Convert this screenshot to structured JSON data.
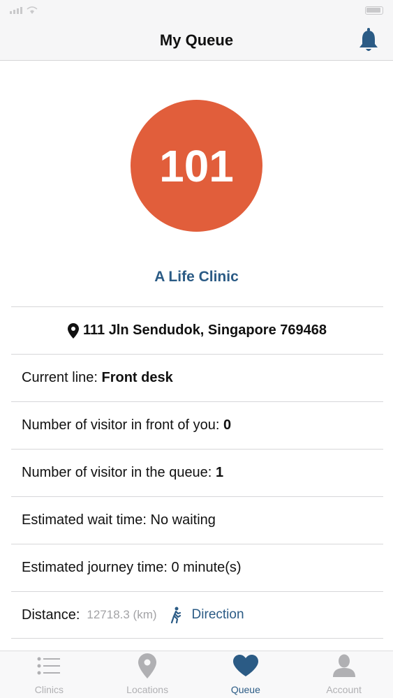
{
  "app": {
    "title": "My Queue"
  },
  "queue": {
    "number": "101",
    "clinic_name": "A Life Clinic",
    "address": "111 Jln Sendudok, Singapore 769468",
    "current_line_label": "Current line: ",
    "current_line_value": "Front desk",
    "visitors_front_label": "Number of visitor in front of you: ",
    "visitors_front_value": "0",
    "visitors_queue_label": "Number of visitor in the queue: ",
    "visitors_queue_value": "1",
    "wait_time_label": "Estimated wait time: ",
    "wait_time_value": "No waiting",
    "journey_time_label": "Estimated journey time: ",
    "journey_time_value": "0 minute(s)",
    "distance_label": "Distance:",
    "distance_value": "12718.3 (km)",
    "direction_label": "Direction"
  },
  "tabs": [
    {
      "label": "Clinics",
      "icon": "list-icon"
    },
    {
      "label": "Locations",
      "icon": "location-pin-icon"
    },
    {
      "label": "Queue",
      "icon": "heart-icon"
    },
    {
      "label": "Account",
      "icon": "person-icon"
    }
  ],
  "colors": {
    "accent": "#2b5b85",
    "badge": "#e15e3b"
  }
}
